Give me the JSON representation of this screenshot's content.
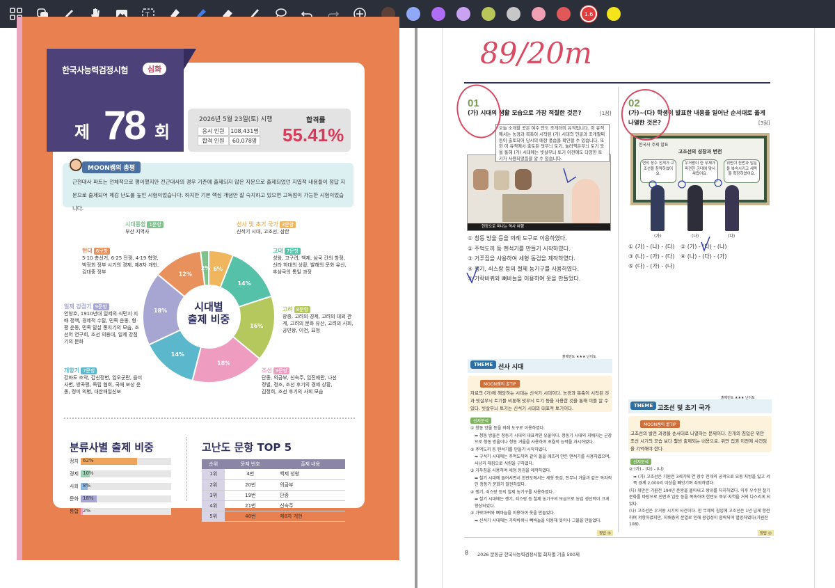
{
  "toolbar": {
    "tools": [
      "grid-icon",
      "layers-icon",
      "pen-icon",
      "hand-icon",
      "image-icon",
      "textbox-icon",
      "eraser-tape-icon",
      "highlighter-icon",
      "eraser-icon",
      "brush-icon",
      "lasso-icon",
      "undo-icon",
      "redo-icon",
      "add-icon"
    ],
    "colors": [
      "#5d4037",
      "#8fa8f7",
      "#b06ef6",
      "#c9a2f4",
      "#b9c65a",
      "#c7c7c7",
      "#f2a0b4",
      "#e15858",
      "#e23b3b",
      "#f5e41a"
    ],
    "selected_size": "1.6"
  },
  "left": {
    "exam_title": "한국사능력검정시험",
    "level": "심화",
    "round_prefix": "제",
    "round_number": "78",
    "round_suffix": "회",
    "date": "2026년 5월 23일(토) 시행",
    "applicants_label": "응시 인원",
    "applicants": "108,431명",
    "passed_label": "합격 인원",
    "passed": "60,078명",
    "rate_label": "합격률",
    "rate": "55.41%",
    "review_label": "MOON쌤의 총평",
    "review_text": "근현대사 파트는 전체적으로 평이했지만 전근대사의 경우 기존에 출제되지 않은 지문으로 출제되었던 지엽적 내용들이 정답 지문으로 출제되어 체감 난도를 높인 시험이었습니다. 하지만 기본 핵심 개념만 잘 숙지하고 있으면 고득점이 가능한 시험이었습니다.",
    "donut_center": [
      "시대별",
      "출제 비중"
    ],
    "categories": [
      {
        "name": "선사 및 초기 국가",
        "count": "3문항",
        "desc": "신석기 시대, 고조선, 삼한",
        "color": "#f0b65e"
      },
      {
        "name": "고대",
        "count": "7문항",
        "desc": "성왕, 고구려, 백제, 삼국 간의 항쟁, 신라 하대의 상황, 발해의 문화 유산, 후삼국의 통일 과정",
        "color": "#56c1a9"
      },
      {
        "name": "고려",
        "count": "8문항",
        "desc": "광종, 고려의 경제, 고려의 대외 관계, 고려의 문화 유산, 고려의 사회, 공민왕, 이천, 묘청",
        "color": "#b5c85e"
      },
      {
        "name": "조선",
        "count": "9문항",
        "desc": "단종, 의금부, 신숙주, 임진왜란, 나선 정벌, 정조, 조선 후기의 경제 상황, 김정희, 조선 후기의 사회 모습",
        "color": "#ee9cbf"
      },
      {
        "name": "개항기",
        "count": "7문항",
        "desc": "강화도 조약, 갑신정변, 임오군란, 을미사변, 방곡령, 독립 협회, 국채 보상 운동, 정미 의병, 대한매일신보",
        "color": "#5bb7cc"
      },
      {
        "name": "일제 강점기",
        "count": "9문항",
        "desc": "안창호, 1910년대 일제의 식민지 지배 정책, 경제적 수탈, 민족 운동, 형평 운동, 민족 말살 통치기의 모습, 조선어 연구회, 조선 의용대, 일제 강점기의 문화",
        "color": "#a7a6d3"
      },
      {
        "name": "현대",
        "count": "6문항",
        "desc": "5·10 총선거, 6·25 전쟁, 4·19 혁명, 박정희 정부 시기의 경제, 제8차 개헌, 김대중 정부",
        "color": "#e8915d"
      },
      {
        "name": "시대통합",
        "count": "1문항",
        "desc": "부산 지역사",
        "color": "#7fc28d"
      }
    ],
    "slices": [
      {
        "label": "6%",
        "value": 6,
        "color": "#f0b65e"
      },
      {
        "label": "14%",
        "value": 14,
        "color": "#56c1a9"
      },
      {
        "label": "16%",
        "value": 16,
        "color": "#b5c85e"
      },
      {
        "label": "18%",
        "value": 18,
        "color": "#ee9cbf"
      },
      {
        "label": "14%",
        "value": 14,
        "color": "#5bb7cc"
      },
      {
        "label": "18%",
        "value": 18,
        "color": "#a7a6d3"
      },
      {
        "label": "12%",
        "value": 12,
        "color": "#e8915d"
      },
      {
        "label": "2%",
        "value": 2,
        "color": "#7fc28d"
      }
    ],
    "classification_title": "분류사별 출제 비중",
    "classification": [
      {
        "name": "정치",
        "pct": "62%",
        "value": 62,
        "color": "#f0a45b"
      },
      {
        "name": "경제",
        "pct": "10%",
        "value": 10,
        "color": "#9fd0b3"
      },
      {
        "name": "사회",
        "pct": "8%",
        "value": 8,
        "color": "#8fb6dc"
      },
      {
        "name": "문화",
        "pct": "18%",
        "value": 18,
        "color": "#a7a6d3"
      },
      {
        "name": "통합",
        "pct": "2%",
        "value": 2,
        "color": "#ee9cbf"
      }
    ],
    "difficulty_title": "고난도 문항 TOP 5",
    "difficulty_headers": [
      "순위",
      "문제 번호",
      "출제 내용"
    ],
    "difficulty_rows": [
      [
        "1위",
        "4번",
        "백제 성왕"
      ],
      [
        "2위",
        "20번",
        "의금부"
      ],
      [
        "3위",
        "19번",
        "단종"
      ],
      [
        "4위",
        "21번",
        "신숙주"
      ],
      [
        "5위",
        "48번",
        "제8차 개헌"
      ]
    ]
  },
  "right": {
    "handwritten_score": "89/20m",
    "q1": {
      "number": "01",
      "text": "(가) 시대의 생활 모습으로 가장 적절한 것은?",
      "score": "[1점]",
      "passage": "오늘 소개할 곳은 여수 안도 조개더미 유적입니다. 이 유적에서는 농경과 목축이 시작된 (가) 시대의 인골과 조개팔찌 등이 출토되어 당시의 매장 풍습을 확인할 수 있습니다. 또한 이 유적에서 출토된 덧무늬 토기, 눌러찍은무늬 토기 등을 통해 (가) 시대에는 빗살무늬 토기 이전에도 다양한 토기가 사용되었음을 알 수 있습니다.",
      "video_caption": "현장으로 떠나는 역사 여행",
      "options": [
        "① 청동 방울 등을 의례 도구로 이용하였다.",
        "② 주먹도끼 등 뗀석기를 만들기 시작하였다.",
        "③ 거푸집을 사용하여 세형 동검을 제작하였다.",
        "④ 쟁기, 쇠스랑 등의 철제 농기구를 사용하였다.",
        "⑤ 가락바퀴와 뼈바늘을 이용하여 옷을 만들었다."
      ]
    },
    "q2": {
      "number": "02",
      "text": "(가)~(다) 학생이 발표한 내용을 일어난 순서대로 옳게 나열한 것은?",
      "score": "[3점]",
      "board_head": "한국사 주제 발표",
      "board_title": "고조선의 성장과 변천",
      "bubbles": [
        "연의 장수 진개가 고조선을 침략하였어요.",
        "우거왕이 한 무제가 파견한 군대에 맞서 싸웠어요.",
        "위만이 진번과 임둔을 복속시키고 세력을 확장하였어요."
      ],
      "students": [
        "(가)",
        "(나)",
        "(다)"
      ],
      "options": [
        "① (가) - (나) - (다)",
        "② (가) - (다) - (나)",
        "③ (나) - (가) - (다)",
        "④ (나) - (다) - (가)",
        "⑤ (다) - (가) - (나)"
      ]
    },
    "theme1": {
      "label": "THEME",
      "title": "선사 시대",
      "freq": "출제빈도 ★★★  난이도",
      "tip_label": "MOON쌤의 꿀TIP",
      "tip": "자료의 (가)에 해당하는 시대는 신석기 시대이다. 농경과 목축이 시작된 것과 빗살무늬 토기를 비롯해 덧무늬 토기 등을 사용한 것을 통해 이를 알 수 있다. 빗살무늬 토기는 신석기 시대의 대표적 토기이다.",
      "analysis_label": "선지분석",
      "analysis": [
        "① 청동 방울 등을 의례 도구로 이용하였다.",
        "➡ 청동 방울은 청동기 시대의 대표적인 유물이다. 청동기 시대의 지배자는 군장으로 청동 방울이나 청동 거울을 사용하여 초월적 능력을 과시하였다.",
        "② 주먹도끼 등 뗀석기를 만들기 시작하였다.",
        "➡ 구석기 시대에는 주먹도끼와 같이 돌을 깨뜨려 만든 뗀석기를 사용하였으며, 사냥과 채집으로 식량을 구하였다.",
        "③ 거푸집을 사용하여 세형 동검을 제작하였다.",
        "➡ 철기 시대에 들어서면서 한반도에서는 세형 동검, 잔무늬 거울과 같은 독자적인 청동기 문화가 발전하였다.",
        "④ 쟁기, 쇠스랑 등의 철제 농기구를 사용하였다.",
        "➡ 철기 시대에는 쟁기, 쇠스랑 등 철제 농기구의 보급으로 농업 생산력이 크게 향상되었다.",
        "⑤ 가락바퀴와 뼈바늘을 이용하여 옷을 만들었다.",
        "➡ 신석기 시대에는 가락바퀴나 뼈바늘을 이용해 옷이나 그물을 만들었다."
      ],
      "answer": "정답 ⑤"
    },
    "theme2": {
      "label": "THEME",
      "title": "고조선 및 초기 국가",
      "freq": "출제빈도 ★★★  난이도",
      "tip_label": "MOON쌤의 꿀TIP",
      "tip": "고조선의 발전 과정을 순서대로 나열하는 문제이다. 진개의 침입은 위만 조선 시기의 모습 보다 훨씬 출제되는 내용으로, 위만 집권 이전에 사건임을 기억해야 한다.",
      "analysis_label": "선지분석",
      "analysis": [
        "② (가) - (다) - (나)",
        "➡ (가) 고조선은 기원전 3세기에 연 장수 진개의 공격으로 요동 지방을 잃고 서쪽 경계 2,000리 이상을 빼앗기며 쇠퇴하였다.",
        "(다) 위만은 기원전 194년 준왕을 몰아내고 왕위를 차지하였다. 이후 우수한 철기 문화를 바탕으로 진번과 임둔 등을 복속하여 한반도 북부 지역을 거의 다스리게 되었다.",
        "(나) 고조선은 우거왕 시기의 사건이다. 한 무제의 침입에 고조선은 1년 넘게 항전하며 저항하였지만, 지배층의 분열로 인해 왕검성이 함락되어 멸망하였다(기원전 108)."
      ],
      "answer": "정답 ②"
    },
    "footer_page": "8",
    "footer_title": "2026 문동균 한국사능력검정시험 회차별 기출 500제"
  }
}
